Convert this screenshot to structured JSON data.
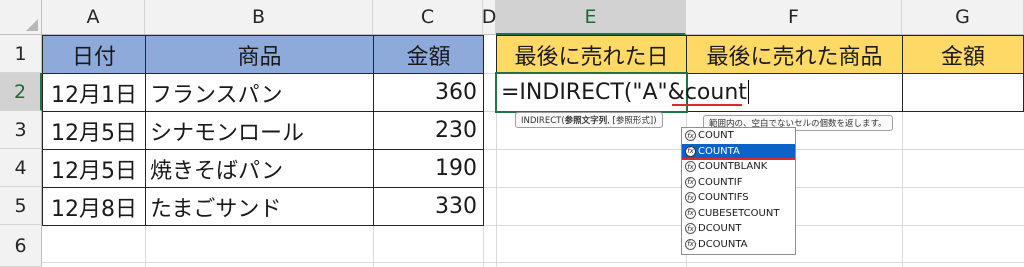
{
  "columns": [
    "A",
    "B",
    "C",
    "D",
    "E",
    "F",
    "G"
  ],
  "rows": [
    "1",
    "2",
    "3",
    "4",
    "5",
    "6"
  ],
  "table1": {
    "headers": [
      "日付",
      "商品",
      "金額"
    ],
    "data": [
      [
        "12月1日",
        "フランスパン",
        "360"
      ],
      [
        "12月5日",
        "シナモンロール",
        "230"
      ],
      [
        "12月5日",
        "焼きそばパン",
        "190"
      ],
      [
        "12月8日",
        "たまごサンド",
        "330"
      ]
    ]
  },
  "table2": {
    "headers": [
      "最後に売れた日",
      "最後に売れた商品",
      "金額"
    ]
  },
  "active_cell": {
    "address": "E2",
    "formula": "=INDIRECT(\"A\"&count"
  },
  "tooltips": {
    "syntax_fn": "INDIRECT(",
    "syntax_arg1": "参照文字列",
    "syntax_rest": ", [参照形式])",
    "description": "範囲内の、空白でないセルの個数を返します。"
  },
  "autocomplete": {
    "items": [
      "COUNT",
      "COUNTA",
      "COUNTBLANK",
      "COUNTIF",
      "COUNTIFS",
      "CUBESETCOUNT",
      "DCOUNT",
      "DCOUNTA"
    ],
    "selected_index": 1
  },
  "colors": {
    "header_blue": "#8eaadb",
    "header_gold": "#ffd966",
    "selection_green": "#217346",
    "autocomplete_selected": "#0b63c9",
    "spell_underline": "#d92b2b"
  }
}
